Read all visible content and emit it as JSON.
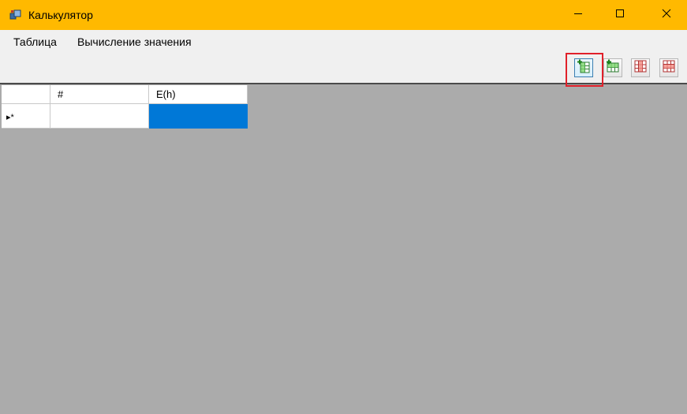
{
  "window": {
    "title": "Калькулятор",
    "icon": "app-window-icon",
    "controls": [
      "minimize-icon",
      "maximize-icon",
      "close-icon"
    ]
  },
  "menu": {
    "items": [
      {
        "label": "Таблица"
      },
      {
        "label": "Вычисление значения"
      }
    ]
  },
  "toolbar": {
    "buttons": [
      {
        "icon": "add-column-icon",
        "highlighted": true
      },
      {
        "icon": "add-row-icon"
      },
      {
        "icon": "delete-column-icon"
      },
      {
        "icon": "delete-row-icon"
      }
    ]
  },
  "grid": {
    "columns": [
      "#",
      "E(h)"
    ],
    "new_row_marker": "▸*",
    "rows": [
      {
        "cells": [
          "",
          ""
        ],
        "selected_cell": 1
      }
    ]
  },
  "colors": {
    "titlebar": "#ffb900",
    "selection": "#0078d7",
    "workspace": "#ababab",
    "highlight_box": "#e0202a"
  }
}
